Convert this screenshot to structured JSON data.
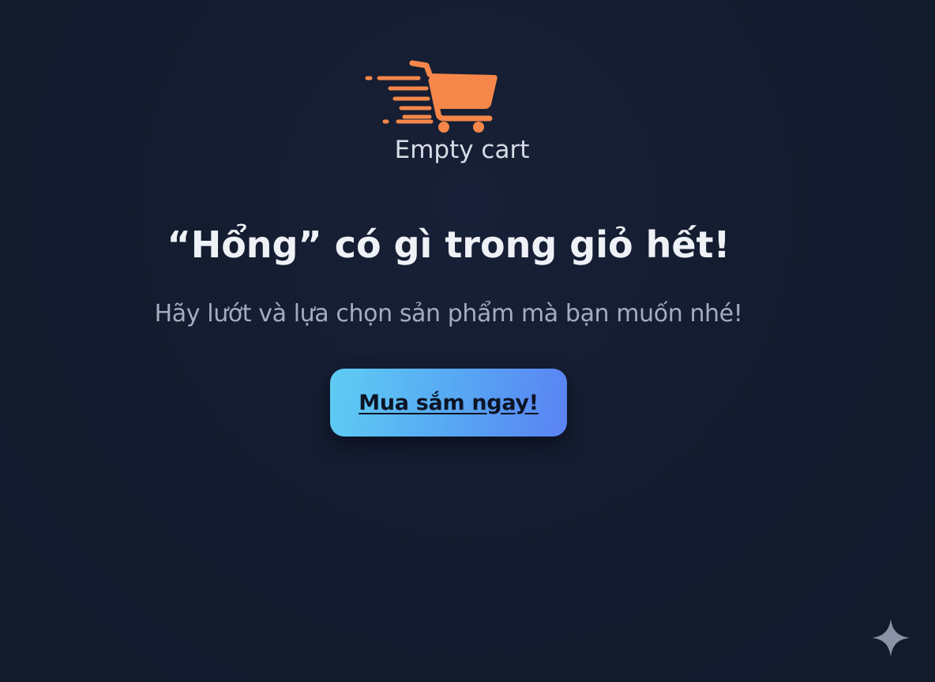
{
  "empty_state": {
    "illustration_icon": "speeding-shopping-cart-icon",
    "illustration_color": "#f5874a",
    "caption": "Empty cart",
    "headline": "“Hổng” có gì trong giỏ hết!",
    "subtitle": "Hãy lướt và lựa chọn sản phẩm mà bạn muốn nhé!",
    "cta_label": "Mua sắm ngay!"
  },
  "corner_badge": {
    "icon": "sparkle-icon",
    "color": "#8a93a5"
  },
  "colors": {
    "background": "#131b2e",
    "headline": "#eef1f6",
    "subtitle": "#a4adc0",
    "button_gradient_start": "#5fcdf3",
    "button_gradient_end": "#5a82f3"
  }
}
